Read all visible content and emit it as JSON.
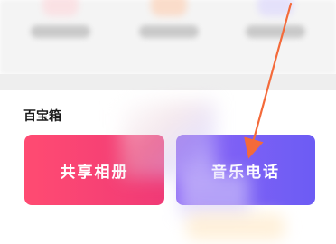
{
  "toolbox": {
    "title": "百宝箱",
    "tiles": [
      {
        "label": "共享相册",
        "color": "#f23f74"
      },
      {
        "label": "音乐电话",
        "color": "#7d62f5"
      }
    ]
  },
  "annotation": {
    "arrow_color": "#f46a3a"
  }
}
